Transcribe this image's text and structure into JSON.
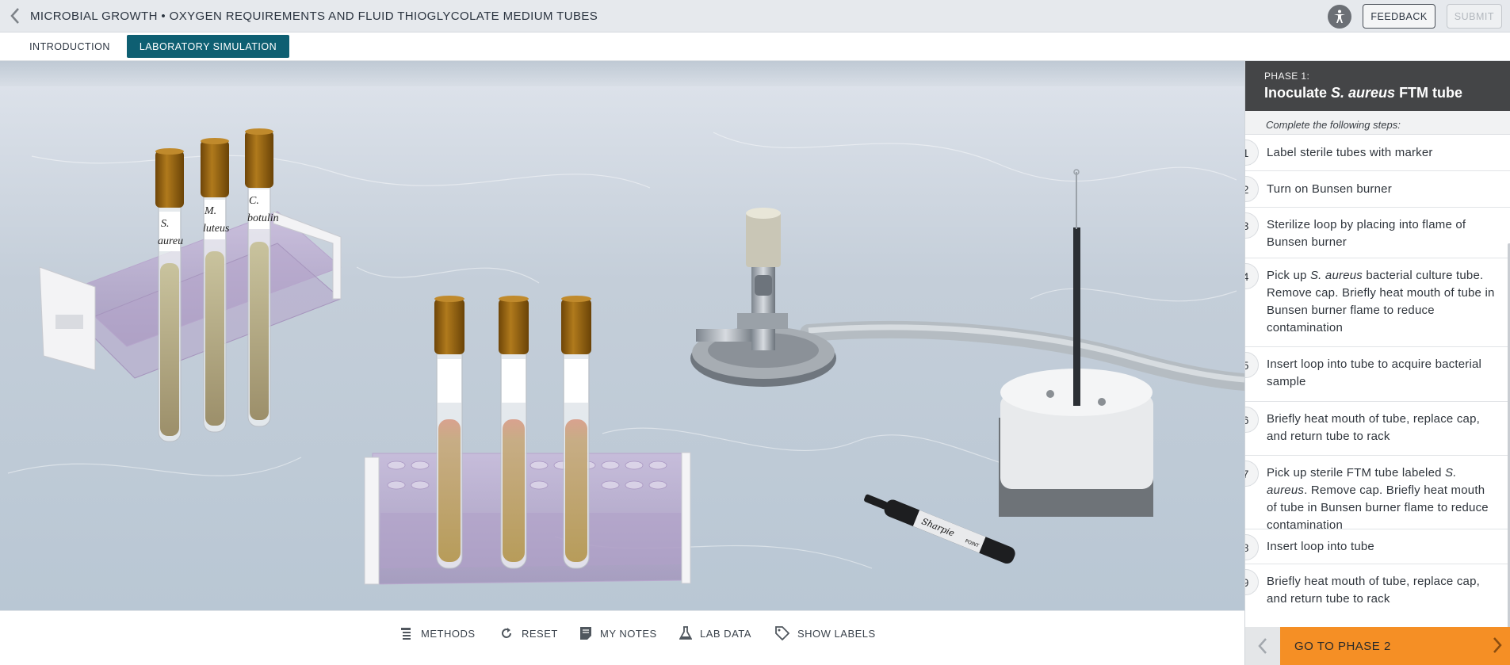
{
  "header": {
    "title": "MICROBIAL GROWTH • OXYGEN REQUIREMENTS AND FLUID THIOGLYCOLATE MEDIUM TUBES",
    "feedback_label": "FEEDBACK",
    "submit_label": "SUBMIT"
  },
  "tabs": [
    {
      "label": "INTRODUCTION",
      "active": false
    },
    {
      "label": "LABORATORY SIMULATION",
      "active": true
    }
  ],
  "scene": {
    "tube_labels": [
      {
        "line1": "S.",
        "line2": "aureu"
      },
      {
        "line1": "M.",
        "line2": "luteus"
      },
      {
        "line1": "C.",
        "line2": "botulin"
      }
    ],
    "marker_label": "Sharpie",
    "marker_sub": "POINT"
  },
  "toolbar": [
    {
      "label": "METHODS",
      "icon": "list-icon"
    },
    {
      "label": "RESET",
      "icon": "reset-icon"
    },
    {
      "label": "MY NOTES",
      "icon": "notes-icon"
    },
    {
      "label": "LAB DATA",
      "icon": "flask-icon"
    },
    {
      "label": "SHOW LABELS",
      "icon": "tag-icon"
    }
  ],
  "panel": {
    "phase_label": "PHASE 1:",
    "phase_title_pre": "Inoculate ",
    "phase_title_em": "S. aureus",
    "phase_title_post": " FTM tube",
    "instructions": "Complete the following steps:",
    "steps": [
      {
        "num": "1",
        "text": "Label sterile tubes with marker"
      },
      {
        "num": "2",
        "text": "Turn on Bunsen burner"
      },
      {
        "num": "3",
        "text": "Sterilize loop by placing into flame of Bunsen burner"
      },
      {
        "num": "4",
        "text_pre": "Pick up ",
        "text_em": "S. aureus",
        "text_post": " bacterial culture tube. Remove cap. Briefly heat mouth of tube in Bunsen burner flame to reduce contamination"
      },
      {
        "num": "5",
        "text": "Insert loop into tube to acquire bacterial sample"
      },
      {
        "num": "6",
        "text": "Briefly heat mouth of tube, replace cap, and return tube to rack"
      },
      {
        "num": "7",
        "text_pre": "Pick up sterile FTM tube labeled ",
        "text_em": "S. aureus",
        "text_post": ". Remove cap. Briefly heat mouth of tube in Bunsen burner flame to reduce contamination"
      },
      {
        "num": "8",
        "text": "Insert loop into tube"
      },
      {
        "num": "9",
        "text": "Briefly heat mouth of tube, replace cap, and return tube to rack"
      }
    ],
    "next_label": "GO TO PHASE 2"
  },
  "colors": {
    "active_tab": "#0e5f72",
    "phase_header": "#444547",
    "next_button": "#f58f25",
    "tube_cap": "#8a5a12"
  }
}
